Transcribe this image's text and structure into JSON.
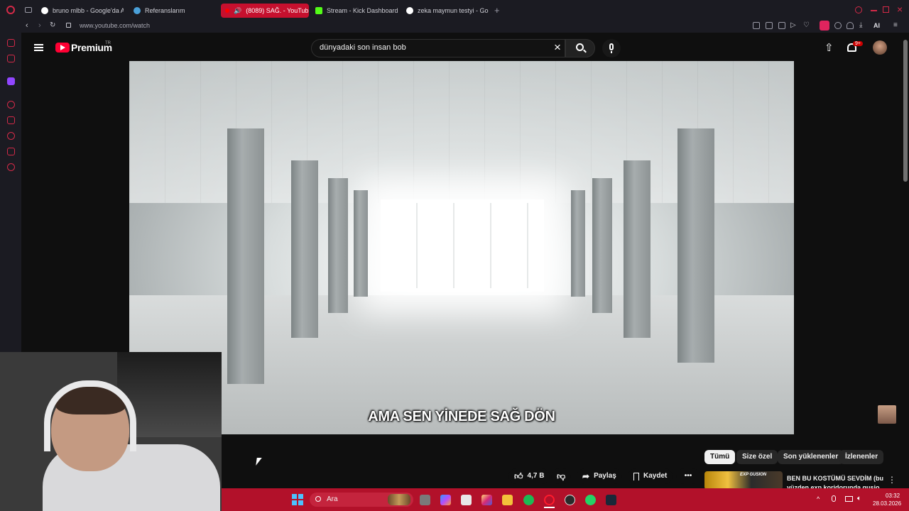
{
  "browser": {
    "tabs": [
      {
        "label": "bruno mlbb - Google'da A",
        "favicon_color": "#ffffff"
      },
      {
        "label": "Referanslarım",
        "favicon_color": "#4aa0d8"
      },
      {
        "label": "(8089) SAĞ. - YouTube",
        "favicon_color": "#ff0000",
        "active": true
      },
      {
        "label": "Stream - Kick Dashboard",
        "favicon_color": "#53fc18"
      },
      {
        "label": "zeka maymun testyi - Goo",
        "favicon_color": "#ffffff"
      }
    ],
    "new_tab": "+",
    "url": "www.youtube.com/watch",
    "ai_label": "AI"
  },
  "youtube": {
    "logo_text": "Premium",
    "region": "TR",
    "search_query": "dünyadaki son insan bob",
    "clear_symbol": "×",
    "notification_badge": "9+",
    "accent_color": "#ff0033"
  },
  "video": {
    "subtitle": "AMA SEN YİNEDE SAĞ DÖN"
  },
  "actions": {
    "like_count": "4,7 B",
    "share_label": "Paylaş",
    "save_label": "Kaydet",
    "more": "•••"
  },
  "chips": [
    "Tümü",
    "Size özel",
    "Son yüklenenler",
    "İzlenenler"
  ],
  "recommendation": {
    "title": "BEN BU KOSTÜMÜ SEVDİM (bu yüzden exp koridorunda gusio",
    "thumb_label": "EXP GUSION"
  },
  "taskbar": {
    "search_placeholder": "Ara",
    "time": "03:32",
    "date": "28.03.2026",
    "color": "#b2112a"
  }
}
